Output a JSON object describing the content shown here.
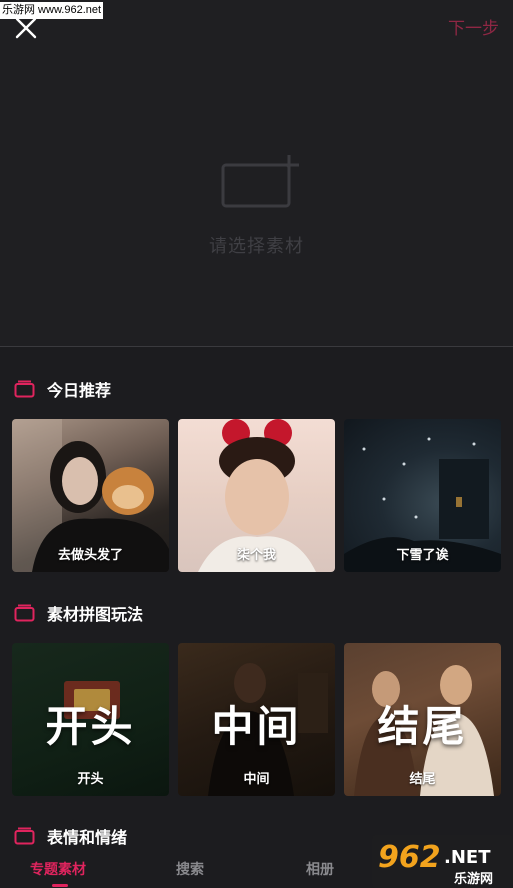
{
  "watermark": "乐游网 www.962.net",
  "header": {
    "next_label": "下一步"
  },
  "placeholder": {
    "text": "请选择素材"
  },
  "sections": [
    {
      "title": "今日推荐",
      "cards": [
        {
          "label": "去做头发了"
        },
        {
          "label": "柒个我"
        },
        {
          "label": "下雪了诶"
        }
      ]
    },
    {
      "title": "素材拼图玩法",
      "cards": [
        {
          "big": "开头",
          "label": "开头"
        },
        {
          "big": "中间",
          "label": "中间"
        },
        {
          "big": "结尾",
          "label": "结尾"
        }
      ]
    },
    {
      "title": "表情和情绪"
    }
  ],
  "tabs": [
    {
      "label": "专题素材",
      "active": true
    },
    {
      "label": "搜索"
    },
    {
      "label": "相册"
    }
  ],
  "logo": {
    "number": "962",
    "suffix": ".NET",
    "subtitle": "乐游网"
  },
  "colors": {
    "accent": "#e0245e",
    "next_muted": "#8f2744",
    "background": "#1c1c1f"
  }
}
